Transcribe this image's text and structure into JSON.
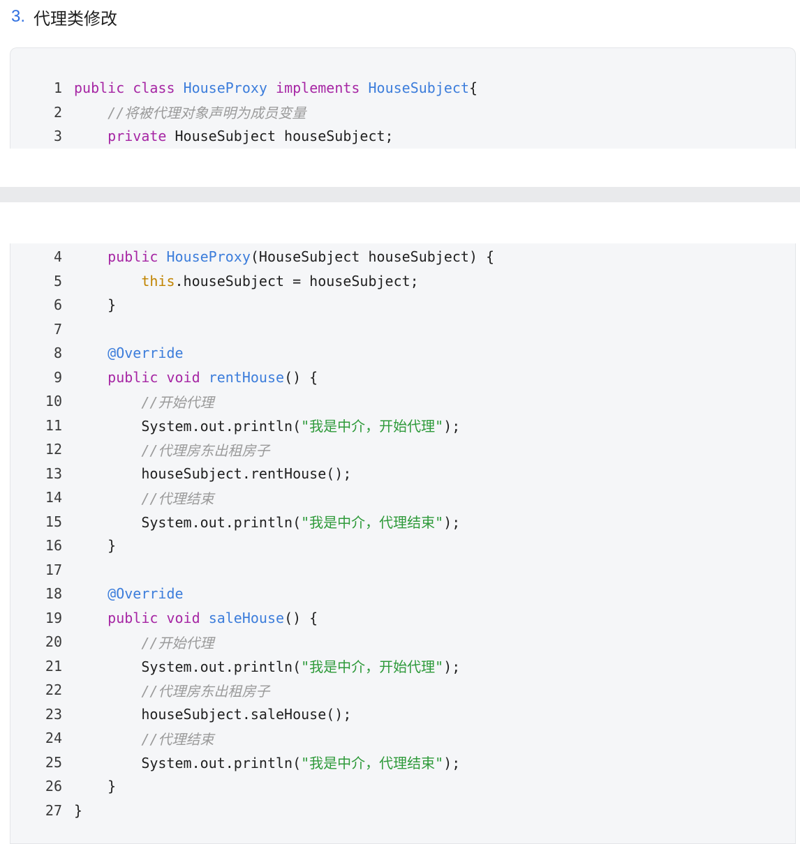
{
  "heading": {
    "number": "3.",
    "title": "代理类修改"
  },
  "block1": {
    "lines": [
      {
        "n": "1",
        "parts": [
          {
            "t": "public",
            "c": "kw"
          },
          {
            "t": " ",
            "c": "pl"
          },
          {
            "t": "class",
            "c": "kw"
          },
          {
            "t": " ",
            "c": "pl"
          },
          {
            "t": "HouseProxy",
            "c": "ty"
          },
          {
            "t": " ",
            "c": "pl"
          },
          {
            "t": "implements",
            "c": "kw"
          },
          {
            "t": " ",
            "c": "pl"
          },
          {
            "t": "HouseSubject",
            "c": "ty"
          },
          {
            "t": "{",
            "c": "pl"
          }
        ]
      },
      {
        "n": "2",
        "parts": [
          {
            "t": "    ",
            "c": "pl"
          },
          {
            "t": "//将被代理对象声明为成员变量",
            "c": "cm"
          }
        ]
      },
      {
        "n": "3",
        "parts": [
          {
            "t": "    ",
            "c": "pl"
          },
          {
            "t": "private",
            "c": "kw"
          },
          {
            "t": " HouseSubject houseSubject;",
            "c": "pl"
          }
        ]
      }
    ]
  },
  "block2": {
    "lines": [
      {
        "n": "4",
        "parts": [
          {
            "t": "    ",
            "c": "pl"
          },
          {
            "t": "public",
            "c": "kw"
          },
          {
            "t": " ",
            "c": "pl"
          },
          {
            "t": "HouseProxy",
            "c": "fn"
          },
          {
            "t": "(HouseSubject houseSubject) {",
            "c": "pl"
          }
        ]
      },
      {
        "n": "5",
        "parts": [
          {
            "t": "        ",
            "c": "pl"
          },
          {
            "t": "this",
            "c": "th"
          },
          {
            "t": ".houseSubject = houseSubject;",
            "c": "pl"
          }
        ]
      },
      {
        "n": "6",
        "parts": [
          {
            "t": "    }",
            "c": "pl"
          }
        ]
      },
      {
        "n": "7",
        "parts": []
      },
      {
        "n": "8",
        "parts": [
          {
            "t": "    ",
            "c": "pl"
          },
          {
            "t": "@Override",
            "c": "an"
          }
        ]
      },
      {
        "n": "9",
        "parts": [
          {
            "t": "    ",
            "c": "pl"
          },
          {
            "t": "public",
            "c": "kw"
          },
          {
            "t": " ",
            "c": "pl"
          },
          {
            "t": "void",
            "c": "kw"
          },
          {
            "t": " ",
            "c": "pl"
          },
          {
            "t": "rentHouse",
            "c": "fn"
          },
          {
            "t": "() {",
            "c": "pl"
          }
        ]
      },
      {
        "n": "10",
        "parts": [
          {
            "t": "        ",
            "c": "pl"
          },
          {
            "t": "//开始代理",
            "c": "cm"
          }
        ]
      },
      {
        "n": "11",
        "parts": [
          {
            "t": "        System.out.println(",
            "c": "pl"
          },
          {
            "t": "\"我是中介，开始代理\"",
            "c": "st"
          },
          {
            "t": ");",
            "c": "pl"
          }
        ]
      },
      {
        "n": "12",
        "parts": [
          {
            "t": "        ",
            "c": "pl"
          },
          {
            "t": "//代理房东出租房子",
            "c": "cm"
          }
        ]
      },
      {
        "n": "13",
        "parts": [
          {
            "t": "        houseSubject.rentHouse();",
            "c": "pl"
          }
        ]
      },
      {
        "n": "14",
        "parts": [
          {
            "t": "        ",
            "c": "pl"
          },
          {
            "t": "//代理结束",
            "c": "cm"
          }
        ]
      },
      {
        "n": "15",
        "parts": [
          {
            "t": "        System.out.println(",
            "c": "pl"
          },
          {
            "t": "\"我是中介，代理结束\"",
            "c": "st"
          },
          {
            "t": ");",
            "c": "pl"
          }
        ]
      },
      {
        "n": "16",
        "parts": [
          {
            "t": "    }",
            "c": "pl"
          }
        ]
      },
      {
        "n": "17",
        "parts": []
      },
      {
        "n": "18",
        "parts": [
          {
            "t": "    ",
            "c": "pl"
          },
          {
            "t": "@Override",
            "c": "an"
          }
        ]
      },
      {
        "n": "19",
        "parts": [
          {
            "t": "    ",
            "c": "pl"
          },
          {
            "t": "public",
            "c": "kw"
          },
          {
            "t": " ",
            "c": "pl"
          },
          {
            "t": "void",
            "c": "kw"
          },
          {
            "t": " ",
            "c": "pl"
          },
          {
            "t": "saleHouse",
            "c": "fn"
          },
          {
            "t": "() {",
            "c": "pl"
          }
        ]
      },
      {
        "n": "20",
        "parts": [
          {
            "t": "        ",
            "c": "pl"
          },
          {
            "t": "//开始代理",
            "c": "cm"
          }
        ]
      },
      {
        "n": "21",
        "parts": [
          {
            "t": "        System.out.println(",
            "c": "pl"
          },
          {
            "t": "\"我是中介，开始代理\"",
            "c": "st"
          },
          {
            "t": ");",
            "c": "pl"
          }
        ]
      },
      {
        "n": "22",
        "parts": [
          {
            "t": "        ",
            "c": "pl"
          },
          {
            "t": "//代理房东出租房子",
            "c": "cm"
          }
        ]
      },
      {
        "n": "23",
        "parts": [
          {
            "t": "        houseSubject.saleHouse();",
            "c": "pl"
          }
        ]
      },
      {
        "n": "24",
        "parts": [
          {
            "t": "        ",
            "c": "pl"
          },
          {
            "t": "//代理结束",
            "c": "cm"
          }
        ]
      },
      {
        "n": "25",
        "parts": [
          {
            "t": "        System.out.println(",
            "c": "pl"
          },
          {
            "t": "\"我是中介，代理结束\"",
            "c": "st"
          },
          {
            "t": ");",
            "c": "pl"
          }
        ]
      },
      {
        "n": "26",
        "parts": [
          {
            "t": "    }",
            "c": "pl"
          }
        ]
      },
      {
        "n": "27",
        "parts": [
          {
            "t": "}",
            "c": "pl"
          }
        ]
      }
    ]
  }
}
